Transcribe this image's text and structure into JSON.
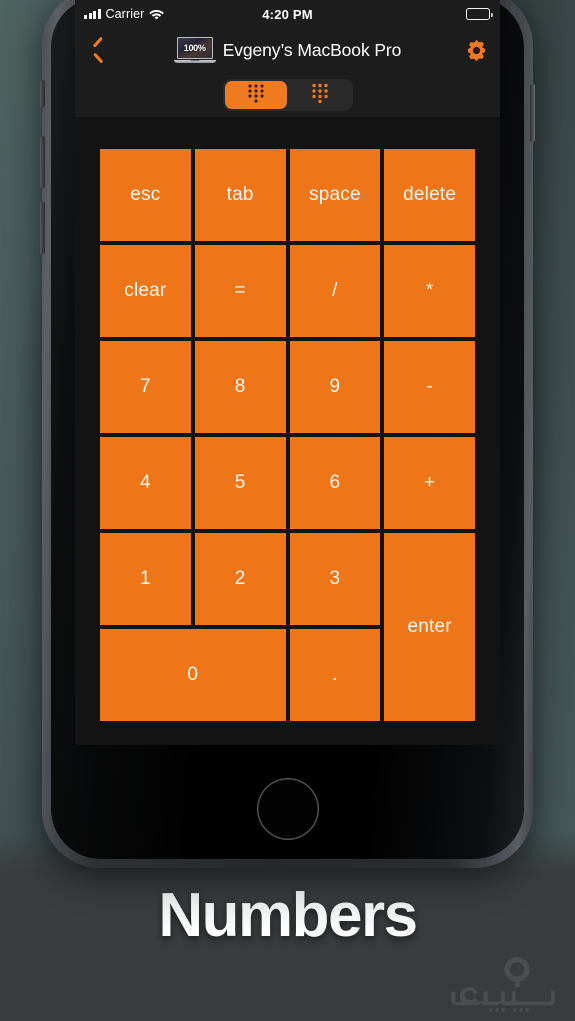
{
  "status_bar": {
    "carrier": "Carrier",
    "time": "4:20 PM",
    "signal_icon": "signal-bars-icon",
    "wifi_icon": "wifi-icon",
    "battery_icon": "battery-icon"
  },
  "nav_bar": {
    "back_icon": "chevron-left-icon",
    "device_thumb_text": "100%",
    "title": "Evgeny’s MacBook Pro",
    "settings_icon": "gear-icon"
  },
  "segmented_control": {
    "options": [
      {
        "name": "numpad-dense-view",
        "icon": "numpad-dots-icon",
        "selected": true
      },
      {
        "name": "numpad-spaced-view",
        "icon": "numpad-dots-spaced-icon",
        "selected": false
      }
    ]
  },
  "keypad": {
    "keys": [
      {
        "label": "esc",
        "name": "key-esc"
      },
      {
        "label": "tab",
        "name": "key-tab"
      },
      {
        "label": "space",
        "name": "key-space"
      },
      {
        "label": "delete",
        "name": "key-delete"
      },
      {
        "label": "clear",
        "name": "key-clear"
      },
      {
        "label": "=",
        "name": "key-equals"
      },
      {
        "label": "/",
        "name": "key-divide"
      },
      {
        "label": "*",
        "name": "key-multiply"
      },
      {
        "label": "7",
        "name": "key-7"
      },
      {
        "label": "8",
        "name": "key-8"
      },
      {
        "label": "9",
        "name": "key-9"
      },
      {
        "label": "-",
        "name": "key-minus"
      },
      {
        "label": "4",
        "name": "key-4"
      },
      {
        "label": "5",
        "name": "key-5"
      },
      {
        "label": "6",
        "name": "key-6"
      },
      {
        "label": "+",
        "name": "key-plus"
      },
      {
        "label": "1",
        "name": "key-1"
      },
      {
        "label": "2",
        "name": "key-2"
      },
      {
        "label": "3",
        "name": "key-3"
      },
      {
        "label": "enter",
        "name": "key-enter",
        "span_rows": 2
      },
      {
        "label": "0",
        "name": "key-0",
        "span_cols": 2
      },
      {
        "label": ".",
        "name": "key-decimal"
      }
    ]
  },
  "caption": {
    "text": "Numbers"
  },
  "watermark": {
    "name": "sibche-logo-watermark"
  },
  "colors": {
    "key_orange": "#ef7519",
    "accent_orange": "#f07c21",
    "screen_background": "#131313",
    "bar_background": "#1d1d1d",
    "key_label": "#fdf6ef"
  }
}
